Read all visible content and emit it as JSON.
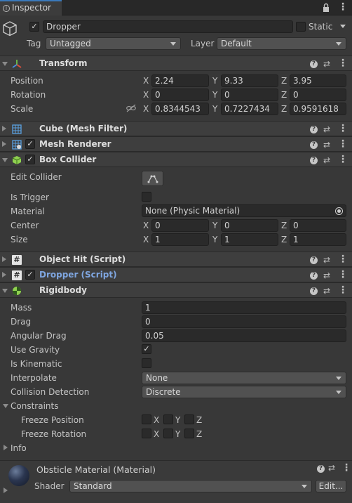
{
  "window": {
    "tab_label": "Inspector",
    "tab_icon": "i"
  },
  "object": {
    "name": "Dropper",
    "active": "✓",
    "static_label": "Static",
    "tag_label": "Tag",
    "tag_value": "Untagged",
    "layer_label": "Layer",
    "layer_value": "Default"
  },
  "transform": {
    "title": "Transform",
    "position": {
      "label": "Position",
      "x": "2.24",
      "y": "9.33",
      "z": "3.95"
    },
    "rotation": {
      "label": "Rotation",
      "x": "0",
      "y": "0",
      "z": "0"
    },
    "scale": {
      "label": "Scale",
      "x": "0.8344543",
      "y": "0.7227434",
      "z": "0.9591618"
    }
  },
  "components": {
    "mesh_filter": {
      "title": "Cube (Mesh Filter)"
    },
    "mesh_renderer": {
      "title": "Mesh Renderer",
      "enabled": "✓"
    },
    "box_collider": {
      "title": "Box Collider",
      "enabled": "✓",
      "edit_collider_label": "Edit Collider",
      "is_trigger_label": "Is Trigger",
      "material_label": "Material",
      "material_value": "None (Physic Material)",
      "center": {
        "label": "Center",
        "x": "0",
        "y": "0",
        "z": "0"
      },
      "size": {
        "label": "Size",
        "x": "1",
        "y": "1",
        "z": "1"
      }
    },
    "object_hit": {
      "title": "Object Hit (Script)"
    },
    "dropper_script": {
      "title": "Dropper (Script)",
      "enabled": "✓"
    },
    "rigidbody": {
      "title": "Rigidbody",
      "mass_label": "Mass",
      "mass": "1",
      "drag_label": "Drag",
      "drag": "0",
      "angular_drag_label": "Angular Drag",
      "angular_drag": "0.05",
      "use_gravity_label": "Use Gravity",
      "use_gravity": "✓",
      "is_kinematic_label": "Is Kinematic",
      "interpolate_label": "Interpolate",
      "interpolate": "None",
      "collision_label": "Collision Detection",
      "collision": "Discrete",
      "constraints_label": "Constraints",
      "freeze_position_label": "Freeze Position",
      "freeze_rotation_label": "Freeze Rotation",
      "info_label": "Info"
    }
  },
  "axes": {
    "x": "X",
    "y": "Y",
    "z": "Z"
  },
  "material": {
    "name": "Obsticle Material (Material)",
    "shader_label": "Shader",
    "shader_value": "Standard",
    "edit_button": "Edit..."
  },
  "colors": {
    "accent_blue": "#3a79bb",
    "script_link": "#7fa6e0",
    "background": "#383838"
  }
}
